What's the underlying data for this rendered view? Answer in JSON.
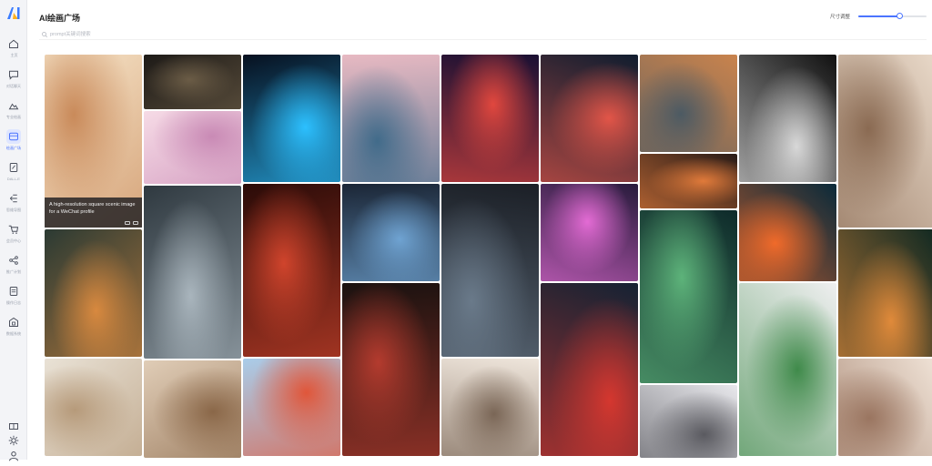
{
  "app": {
    "title": "AI绘画广场"
  },
  "sidebar": {
    "items": [
      {
        "label": "主页",
        "icon": "home-icon",
        "active": false
      },
      {
        "label": "对话聊天",
        "icon": "chat-icon",
        "active": false
      },
      {
        "label": "专业绘画",
        "icon": "image-icon",
        "active": false
      },
      {
        "label": "绘画广场",
        "icon": "gallery-icon",
        "active": true
      },
      {
        "label": "DALL-E",
        "icon": "brush-icon",
        "active": false
      },
      {
        "label": "思维导图",
        "icon": "mindmap-icon",
        "active": false
      },
      {
        "label": "会员中心",
        "icon": "cart-icon",
        "active": false
      },
      {
        "label": "推广计划",
        "icon": "share-icon",
        "active": false
      },
      {
        "label": "操作日志",
        "icon": "log-icon",
        "active": false
      },
      {
        "label": "数据系统",
        "icon": "system-icon",
        "active": false
      }
    ],
    "bottom_icons": [
      "gift-icon",
      "settings-icon",
      "user-icon"
    ]
  },
  "toolbar": {
    "size_label": "尺寸调整",
    "slider_level": 0.6
  },
  "search": {
    "placeholder": "prompt关键词搜索"
  },
  "tooltip": {
    "text": "A high-resolution square scenic image for a WeChat profile"
  },
  "colors": {
    "accent": "#4b74ff",
    "sidebar_bg": "#f3f4f7"
  },
  "gallery": {
    "columns": [
      [
        {
          "name": "misty-mountain-painting",
          "h": 190,
          "c1": "#f7e6cb",
          "c2": "#c98a5a"
        },
        {
          "name": "girl-with-goldfish",
          "h": 140,
          "c1": "#2b3a33",
          "c2": "#d8893f"
        },
        {
          "name": "bright-bedroom",
          "h": 107,
          "c1": "#e9e2d6",
          "c2": "#b69a7a"
        }
      ],
      [
        {
          "name": "moonlit-landscapes",
          "h": 60,
          "c1": "#1d1a17",
          "c2": "#6b5c46"
        },
        {
          "name": "pink-chibi-characters",
          "h": 80,
          "c1": "#f6dbe6",
          "c2": "#c98ab5"
        },
        {
          "name": "fantasy-women-grid",
          "h": 190,
          "c1": "#2f3940",
          "c2": "#a9b5bd"
        },
        {
          "name": "woman-in-bedroom",
          "h": 107,
          "c1": "#e0cdb7",
          "c2": "#8a6748"
        }
      ],
      [
        {
          "name": "neon-cola-bottle",
          "h": 140,
          "c1": "#07101f",
          "c2": "#2cc0ff"
        },
        {
          "name": "red-flower-woman",
          "h": 190,
          "c1": "#2a0b08",
          "c2": "#d0442c"
        },
        {
          "name": "straw-hat-boy",
          "h": 107,
          "c1": "#a9cdea",
          "c2": "#e0563a"
        }
      ],
      [
        {
          "name": "pink-mountain-lake",
          "h": 140,
          "c1": "#e7b9c2",
          "c2": "#416b8a"
        },
        {
          "name": "programmer-at-desk",
          "h": 107,
          "c1": "#1b2636",
          "c2": "#6fa3d2"
        },
        {
          "name": "girl-in-red-dress",
          "h": 190,
          "c1": "#1b1210",
          "c2": "#b43b2e"
        }
      ],
      [
        {
          "name": "cosmic-warrior",
          "h": 140,
          "c1": "#1a1033",
          "c2": "#e1473e"
        },
        {
          "name": "man-at-computers",
          "h": 190,
          "c1": "#1b1f26",
          "c2": "#6a7a8a"
        },
        {
          "name": "woman-in-white-sheets",
          "h": 107,
          "c1": "#efe6dc",
          "c2": "#7a6656"
        }
      ],
      [
        {
          "name": "neon-anime-girl",
          "h": 140,
          "c1": "#101d2f",
          "c2": "#e25548"
        },
        {
          "name": "neon-city-cockpit",
          "h": 107,
          "c1": "#281b3c",
          "c2": "#e36bd4"
        },
        {
          "name": "anime-boy-red-suit",
          "h": 190,
          "c1": "#152233",
          "c2": "#d5372f"
        }
      ],
      [
        {
          "name": "sunset-cityscape",
          "h": 107,
          "c1": "#c9834d",
          "c2": "#4c5a63"
        },
        {
          "name": "woman-with-flowers",
          "h": 60,
          "c1": "#2a1c18",
          "c2": "#e07a3a"
        },
        {
          "name": "underwater-butterfly",
          "h": 190,
          "c1": "#0e2a2a",
          "c2": "#5db37a"
        },
        {
          "name": "woman-with-sunglasses",
          "h": 80,
          "c1": "#e8e8ec",
          "c2": "#5a5a60"
        }
      ],
      [
        {
          "name": "sunglasses-portraits",
          "h": 140,
          "c1": "#111111",
          "c2": "#d8d8d8"
        },
        {
          "name": "blue-dragon-mask",
          "h": 107,
          "c1": "#0a2a3a",
          "c2": "#f06a2a"
        },
        {
          "name": "green-coat-swordsman",
          "h": 190,
          "c1": "#efeff0",
          "c2": "#3f8a4a"
        }
      ],
      [
        {
          "name": "women-photo-grid",
          "h": 190,
          "c1": "#e8d8c8",
          "c2": "#8a6a52"
        },
        {
          "name": "forest-with-fish",
          "h": 140,
          "c1": "#112922",
          "c2": "#e08a3a"
        },
        {
          "name": "woman-on-bed",
          "h": 107,
          "c1": "#efe2d6",
          "c2": "#9a7560"
        }
      ]
    ]
  }
}
